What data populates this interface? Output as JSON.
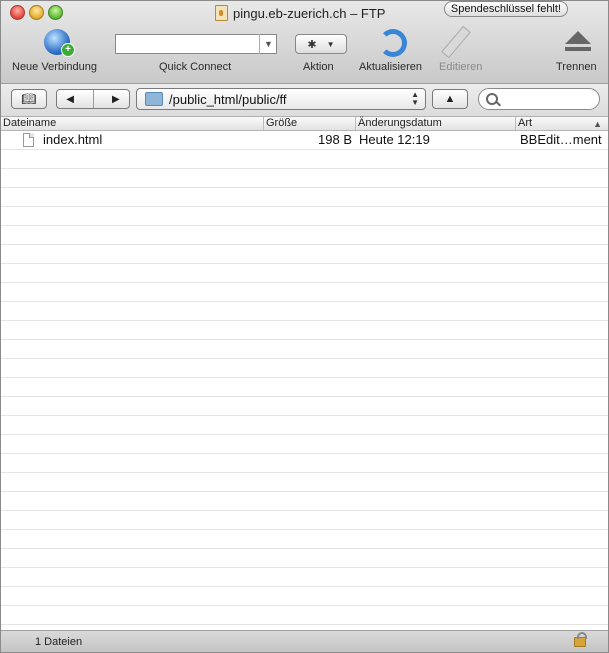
{
  "window": {
    "title": "pingu.eb-zuerich.ch – FTP",
    "badge": "Spendeschlüssel fehlt!"
  },
  "toolbar": {
    "new_connection": "Neue Verbindung",
    "quick_connect": "Quick Connect",
    "quick_connect_value": "",
    "action": "Aktion",
    "refresh": "Aktualisieren",
    "edit": "Editieren",
    "disconnect": "Trennen"
  },
  "pathbar": {
    "path": "/public_html/public/ff",
    "search_placeholder": ""
  },
  "table": {
    "columns": [
      "Dateiname",
      "Größe",
      "Änderungsdatum",
      "Art"
    ],
    "rows": [
      {
        "name": "index.html",
        "size": "198 B",
        "date": "Heute 12:19",
        "kind": "BBEdit…ment"
      }
    ]
  },
  "status": {
    "count_text": "1 Dateien"
  },
  "colors": {
    "accent": "#3a86d6",
    "row_line": "#e4e4e4"
  },
  "icons": [
    "globe-add-icon",
    "gear-icon",
    "refresh-icon",
    "pencil-icon",
    "eject-icon",
    "bookmark-icon",
    "back-arrow-icon",
    "forward-arrow-icon",
    "folder-icon",
    "up-arrow-icon",
    "search-icon",
    "file-icon",
    "lock-icon"
  ]
}
